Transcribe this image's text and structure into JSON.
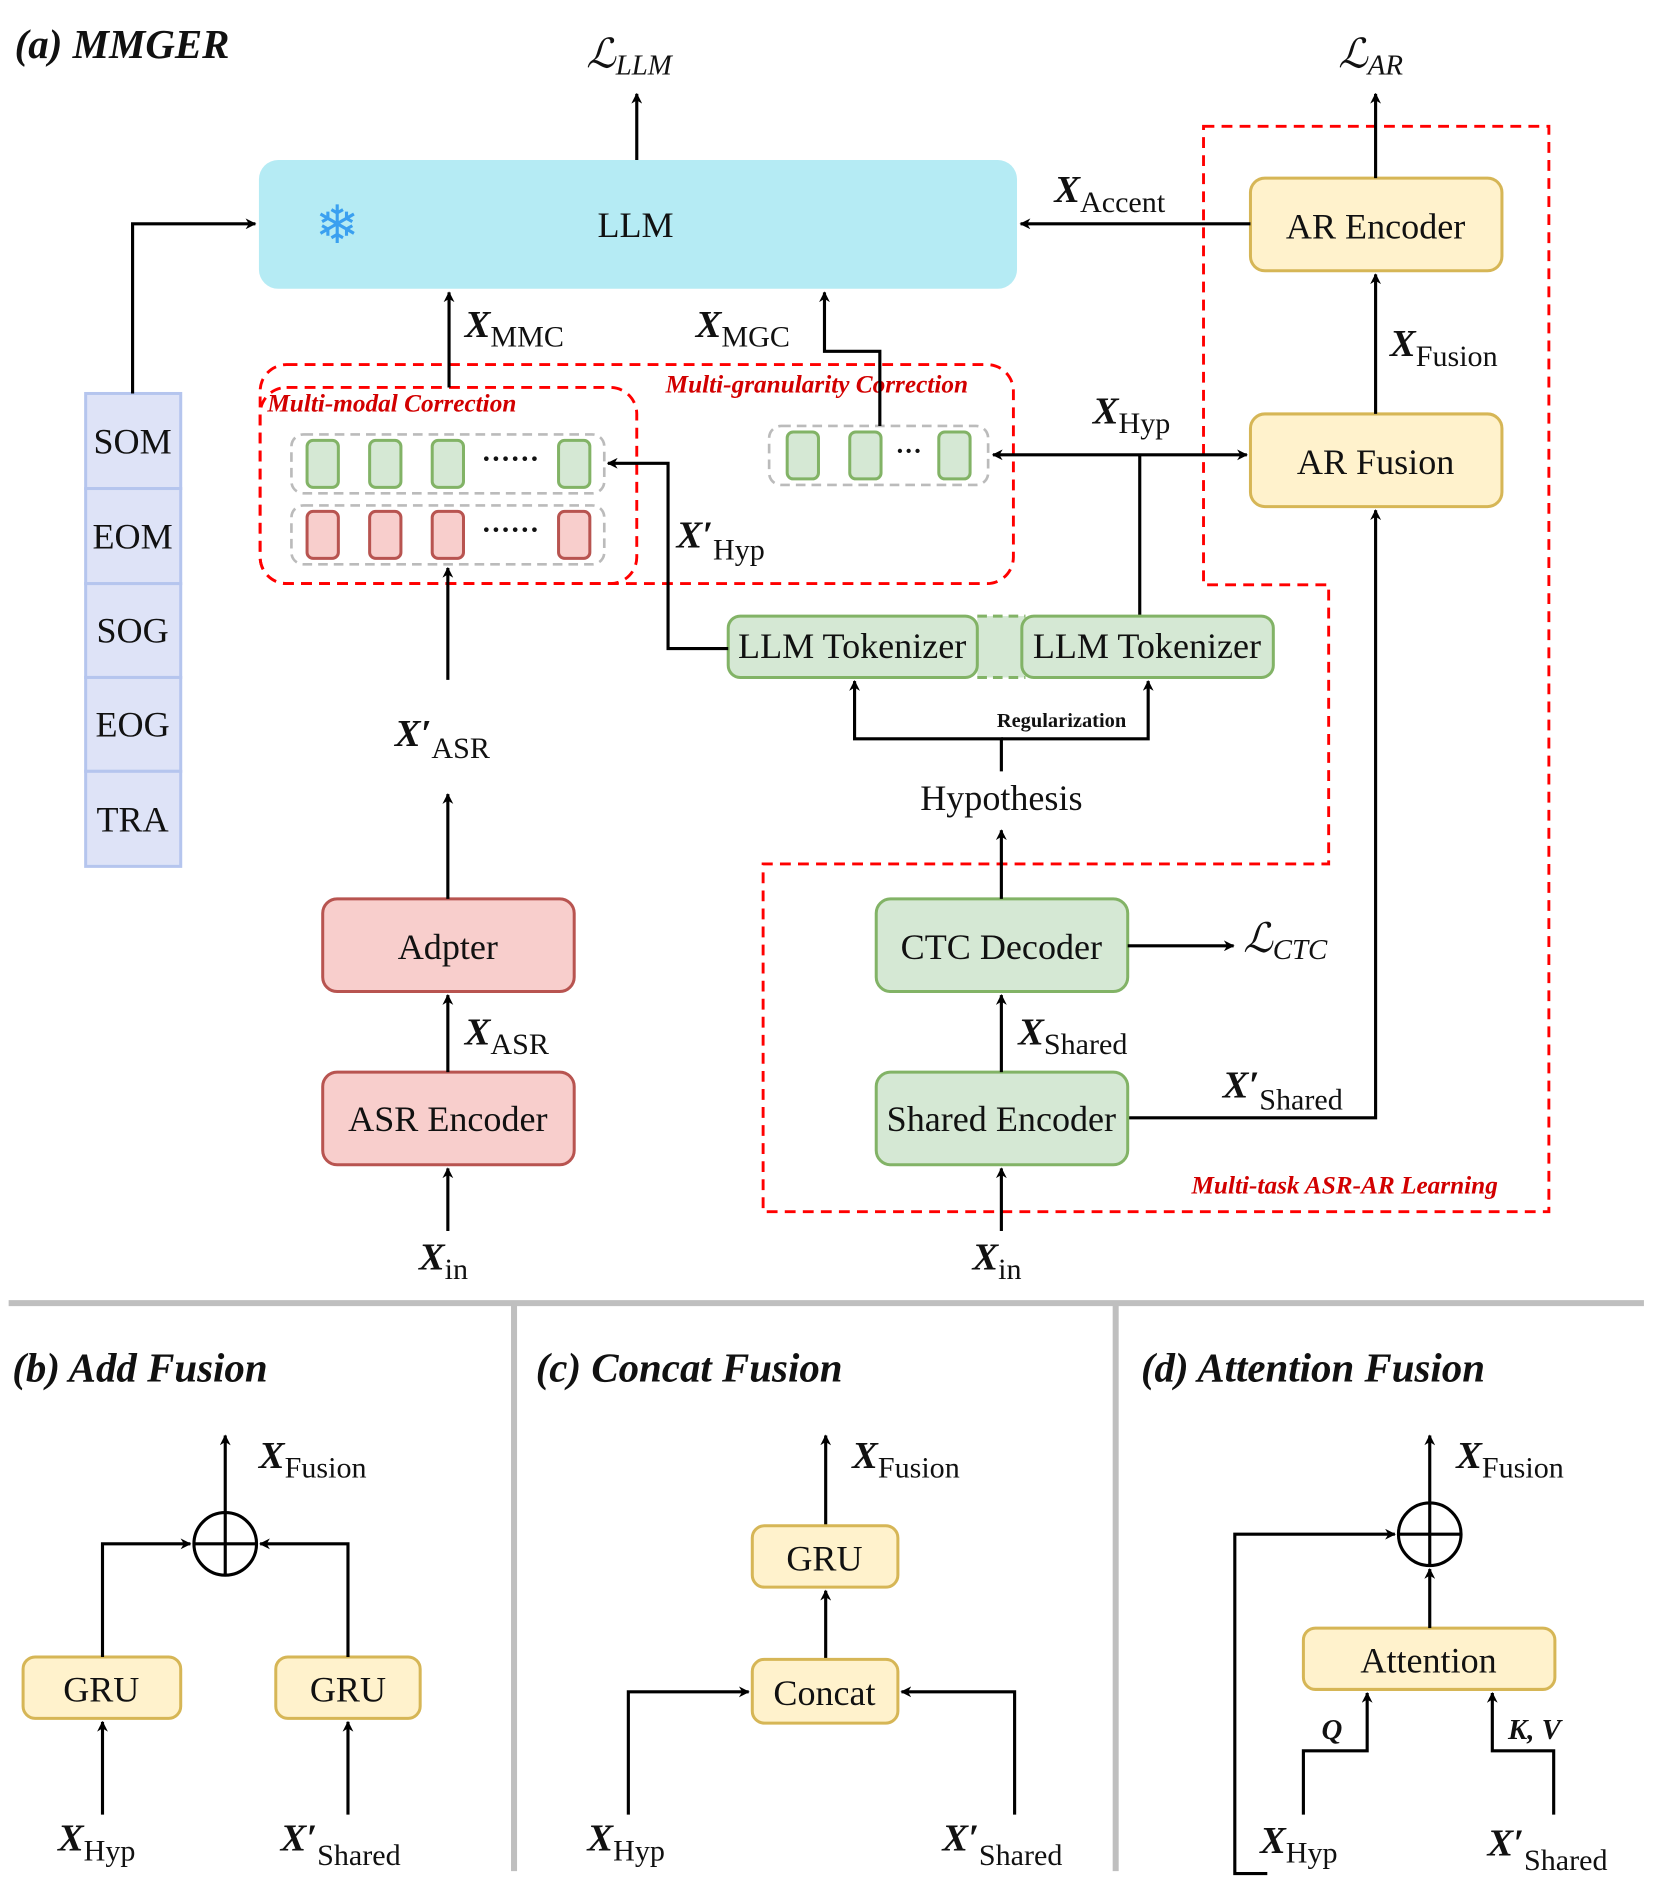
{
  "panel_a": {
    "title": "(a) MMGER",
    "llm": "LLM",
    "snowflake": "❄",
    "loss_llm": {
      "main": "ℒ",
      "sub": "LLM"
    },
    "loss_ar": {
      "main": "ℒ",
      "sub": "AR"
    },
    "loss_ctc": {
      "main": "ℒ",
      "sub": "CTC"
    },
    "ar_encoder": "AR Encoder",
    "ar_fusion": "AR Fusion",
    "x_accent": {
      "main": "X",
      "sub": "Accent"
    },
    "x_fusion": {
      "main": "X",
      "sub": "Fusion"
    },
    "x_mmc": {
      "main": "X",
      "sub": "MMC"
    },
    "x_mgc": {
      "main": "X",
      "sub": "MGC"
    },
    "x_hyp": {
      "main": "X",
      "sub": "Hyp"
    },
    "x_hyp_prime": {
      "main": "X′",
      "sub": "Hyp"
    },
    "x_asr_prime": {
      "main": "X′",
      "sub": "ASR"
    },
    "x_asr": {
      "main": "X",
      "sub": "ASR"
    },
    "x_shared": {
      "main": "X",
      "sub": "Shared"
    },
    "x_shared_prime": {
      "main": "X′",
      "sub": "Shared"
    },
    "x_in": {
      "main": "X",
      "sub": "in"
    },
    "multi_modal_label": "Multi-modal Correction",
    "multi_granularity_label": "Multi-granularity Correction",
    "multi_task_label": "Multi-task ASR-AR Learning",
    "ellipsis_long": "······",
    "ellipsis_short": "···",
    "tokenizer_left": "LLM Tokenizer",
    "tokenizer_right": "LLM Tokenizer",
    "regularization": "Regularization",
    "hypothesis": "Hypothesis",
    "adapter": "Adpter",
    "asr_encoder": "ASR Encoder",
    "ctc_decoder": "CTC Decoder",
    "shared_encoder": "Shared Encoder",
    "special_tokens": [
      "SOM",
      "EOM",
      "SOG",
      "EOG",
      "TRA"
    ]
  },
  "panel_b": {
    "title": "(b) Add Fusion",
    "gru_left": "GRU",
    "gru_right": "GRU",
    "x_fusion": {
      "main": "X",
      "sub": "Fusion"
    },
    "x_hyp": {
      "main": "X",
      "sub": "Hyp"
    },
    "x_shared_prime": {
      "main": "X′",
      "sub": "Shared"
    }
  },
  "panel_c": {
    "title": "(c) Concat Fusion",
    "gru": "GRU",
    "concat": "Concat",
    "x_fusion": {
      "main": "X",
      "sub": "Fusion"
    },
    "x_hyp": {
      "main": "X",
      "sub": "Hyp"
    },
    "x_shared_prime": {
      "main": "X′",
      "sub": "Shared"
    }
  },
  "panel_d": {
    "title": "(d) Attention Fusion",
    "attention": "Attention",
    "q_label": "Q",
    "kv_label": "K, V",
    "x_fusion": {
      "main": "X",
      "sub": "Fusion"
    },
    "x_hyp": {
      "main": "X",
      "sub": "Hyp"
    },
    "x_shared_prime": {
      "main": "X′",
      "sub": "Shared"
    }
  }
}
